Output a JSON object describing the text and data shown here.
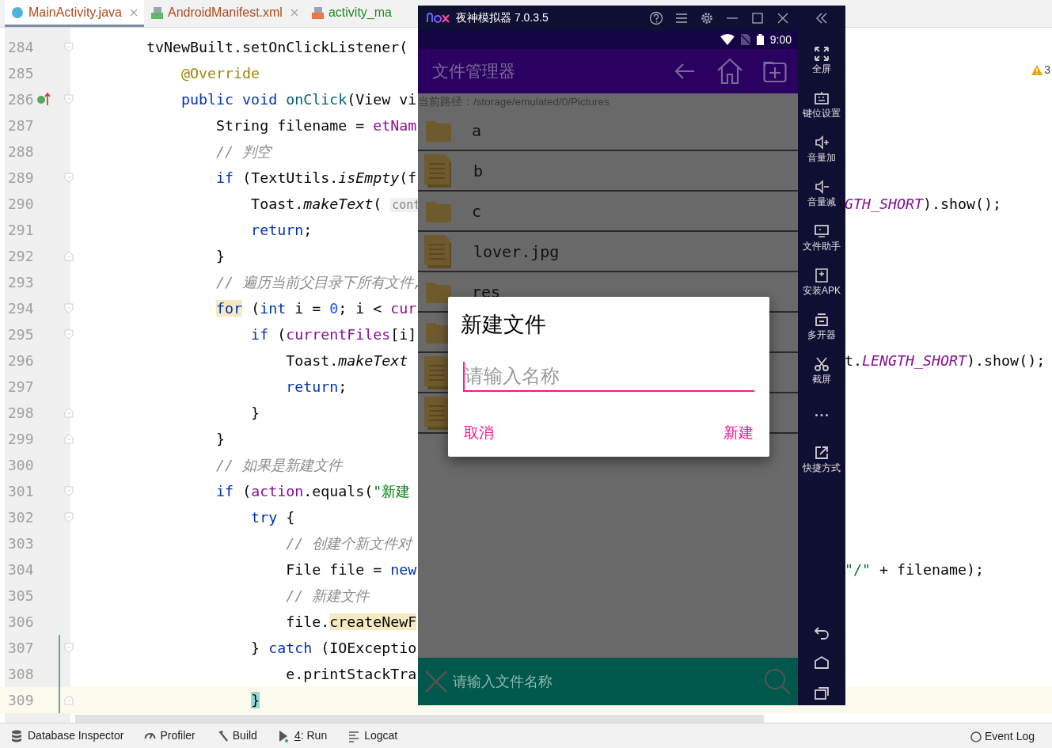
{
  "editor_tabs": [
    {
      "label": "MainActivity.java",
      "kind": "class",
      "selected": true,
      "closable": true
    },
    {
      "label": "AndroidManifest.xml",
      "kind": "manifest",
      "selected": false,
      "closable": true
    },
    {
      "label": "activity_ma",
      "kind": "layout",
      "selected": false,
      "closable": false
    }
  ],
  "warnings": {
    "count": "3"
  },
  "code_lines": [
    {
      "number": "284",
      "fold_start": true,
      "tokens": [
        {
          "t": "        tvNewBuilt.setOnClickListener(",
          "kind": "plain"
        }
      ]
    },
    {
      "number": "285",
      "tokens": [
        {
          "t": "            @Override",
          "kind": "ann"
        }
      ]
    },
    {
      "number": "286",
      "fold_start": true,
      "overridden": true,
      "tokens": [
        {
          "t": "            public void ",
          "kind": "kw"
        },
        {
          "t": "onClick",
          "kind": "method"
        },
        {
          "t": "(View vi",
          "kind": "plain"
        }
      ]
    },
    {
      "number": "287",
      "tokens": [
        {
          "t": "                String filename = ",
          "kind": "plain"
        },
        {
          "t": "etNam",
          "kind": "field"
        }
      ]
    },
    {
      "number": "288",
      "tokens": [
        {
          "t": "                // 判空",
          "kind": "comment"
        }
      ]
    },
    {
      "number": "289",
      "fold_start": true,
      "tokens": [
        {
          "t": "                if",
          "kind": "kw"
        },
        {
          "t": " (TextUtils.",
          "kind": "plain"
        },
        {
          "t": "isEmpty",
          "kind": "italic"
        },
        {
          "t": "(f",
          "kind": "plain"
        }
      ]
    },
    {
      "number": "290",
      "tokens": [
        {
          "t": "                    Toast.",
          "kind": "plain"
        },
        {
          "t": "makeText",
          "kind": "italic"
        },
        {
          "t": "( ",
          "kind": "plain"
        },
        {
          "t": "cont",
          "kind": "hint"
        }
      ],
      "tail": [
        {
          "t": "GTH_SHORT",
          "kind": "static"
        },
        {
          "t": ").show();",
          "kind": "plain"
        }
      ]
    },
    {
      "number": "291",
      "tokens": [
        {
          "t": "                    return",
          "kind": "kw"
        },
        {
          "t": ";",
          "kind": "plain"
        }
      ]
    },
    {
      "number": "292",
      "fold_end": true,
      "tokens": [
        {
          "t": "                }",
          "kind": "plain"
        }
      ]
    },
    {
      "number": "293",
      "tokens": [
        {
          "t": "                // 遍历当前父目录下所有文件,",
          "kind": "comment"
        }
      ]
    },
    {
      "number": "294",
      "fold_start": true,
      "tokens": [
        {
          "t": "                for",
          "kind": "kw_hl"
        },
        {
          "t": " (",
          "kind": "plain"
        },
        {
          "t": "int",
          "kind": "kw"
        },
        {
          "t": " i = ",
          "kind": "plain"
        },
        {
          "t": "0",
          "kind": "num"
        },
        {
          "t": "; i < ",
          "kind": "plain"
        },
        {
          "t": "cur",
          "kind": "field"
        }
      ]
    },
    {
      "number": "295",
      "fold_start": true,
      "tokens": [
        {
          "t": "                    if",
          "kind": "kw"
        },
        {
          "t": " (",
          "kind": "plain"
        },
        {
          "t": "currentFiles",
          "kind": "field"
        },
        {
          "t": "[i]",
          "kind": "plain"
        }
      ]
    },
    {
      "number": "296",
      "tokens": [
        {
          "t": "                        Toast.",
          "kind": "plain"
        },
        {
          "t": "makeText",
          "kind": "italic"
        }
      ],
      "tail": [
        {
          "t": "t.",
          "kind": "plain"
        },
        {
          "t": "LENGTH_SHORT",
          "kind": "static"
        },
        {
          "t": ").show();",
          "kind": "plain"
        }
      ]
    },
    {
      "number": "297",
      "tokens": [
        {
          "t": "                        return",
          "kind": "kw"
        },
        {
          "t": ";",
          "kind": "plain"
        }
      ]
    },
    {
      "number": "298",
      "fold_end": true,
      "tokens": [
        {
          "t": "                    }",
          "kind": "plain"
        }
      ]
    },
    {
      "number": "299",
      "fold_end": true,
      "tokens": [
        {
          "t": "                }",
          "kind": "plain"
        }
      ]
    },
    {
      "number": "300",
      "tokens": [
        {
          "t": "                // 如果是新建文件",
          "kind": "comment"
        }
      ]
    },
    {
      "number": "301",
      "fold_start": true,
      "tokens": [
        {
          "t": "                if",
          "kind": "kw"
        },
        {
          "t": " (",
          "kind": "plain"
        },
        {
          "t": "action",
          "kind": "field"
        },
        {
          "t": ".equals(",
          "kind": "plain"
        },
        {
          "t": "\"新建",
          "kind": "str"
        }
      ]
    },
    {
      "number": "302",
      "fold_start": true,
      "tokens": [
        {
          "t": "                    try",
          "kind": "kw"
        },
        {
          "t": " {",
          "kind": "plain"
        }
      ]
    },
    {
      "number": "303",
      "tokens": [
        {
          "t": "                        // 创建个新文件对",
          "kind": "comment"
        }
      ]
    },
    {
      "number": "304",
      "tokens": [
        {
          "t": "                        File file = ",
          "kind": "plain"
        },
        {
          "t": "new",
          "kind": "kw"
        }
      ],
      "tail": [
        {
          "t": "\"/\"",
          "kind": "str"
        },
        {
          "t": " + filename);",
          "kind": "plain"
        }
      ]
    },
    {
      "number": "305",
      "tokens": [
        {
          "t": "                        // 新建文件",
          "kind": "comment"
        }
      ]
    },
    {
      "number": "306",
      "tokens": [
        {
          "t": "                        file.",
          "kind": "plain"
        },
        {
          "t": "createNewF",
          "kind": "usage_hl"
        }
      ]
    },
    {
      "number": "307",
      "fold_start": true,
      "modified": true,
      "tokens": [
        {
          "t": "                    } ",
          "kind": "plain"
        },
        {
          "t": "catch",
          "kind": "kw"
        },
        {
          "t": " (IOExceptio",
          "kind": "plain"
        }
      ]
    },
    {
      "number": "308",
      "modified": true,
      "tokens": [
        {
          "t": "                        e.printStackTra",
          "kind": "plain"
        }
      ]
    },
    {
      "number": "309",
      "fold_end": true,
      "modified": true,
      "current": true,
      "tokens": [
        {
          "t": "                    }",
          "kind": "brace_hl"
        }
      ]
    }
  ],
  "tool_windows": [
    {
      "label": "Database Inspector",
      "kind": "database"
    },
    {
      "label": "Profiler",
      "kind": "profiler"
    },
    {
      "label": "Build",
      "kind": "build"
    },
    {
      "label": "4: Run",
      "kind": "run"
    },
    {
      "label": "Logcat",
      "kind": "logcat"
    }
  ],
  "event_log": "Event Log",
  "emulator": {
    "title": "夜神模拟器 7.0.3.5",
    "time": "9:00",
    "app": {
      "title": "文件管理器",
      "path": "当前路径：/storage/emulated/0/Pictures",
      "files": [
        {
          "kind": "folder",
          "name": "a"
        },
        {
          "kind": "file",
          "name": "b"
        },
        {
          "kind": "folder",
          "name": "c"
        },
        {
          "kind": "file",
          "name": "lover.jpg"
        },
        {
          "kind": "folder",
          "name": "res"
        },
        {
          "kind": "folder"
        },
        {
          "kind": "file"
        },
        {
          "kind": "file"
        }
      ],
      "search": {
        "placeholder": "请输入文件名称"
      }
    },
    "dialog": {
      "title": "新建文件",
      "placeholder": "请输入名称",
      "cancel": "取消",
      "confirm": "新建"
    },
    "sidebar": [
      {
        "kind": "fullscreen",
        "label": "全屏"
      },
      {
        "kind": "keymap",
        "label": "键位设置"
      },
      {
        "kind": "volume_up",
        "label": "音量加"
      },
      {
        "kind": "volume_down",
        "label": "音量减"
      },
      {
        "kind": "file_helper",
        "label": "文件助手"
      },
      {
        "kind": "apk",
        "label": "安装APK"
      },
      {
        "kind": "multi",
        "label": "多开器"
      },
      {
        "kind": "screenshot",
        "label": "截屏"
      },
      {
        "kind": "more"
      },
      {
        "kind": "shortcut",
        "label": "快捷方式"
      }
    ]
  }
}
